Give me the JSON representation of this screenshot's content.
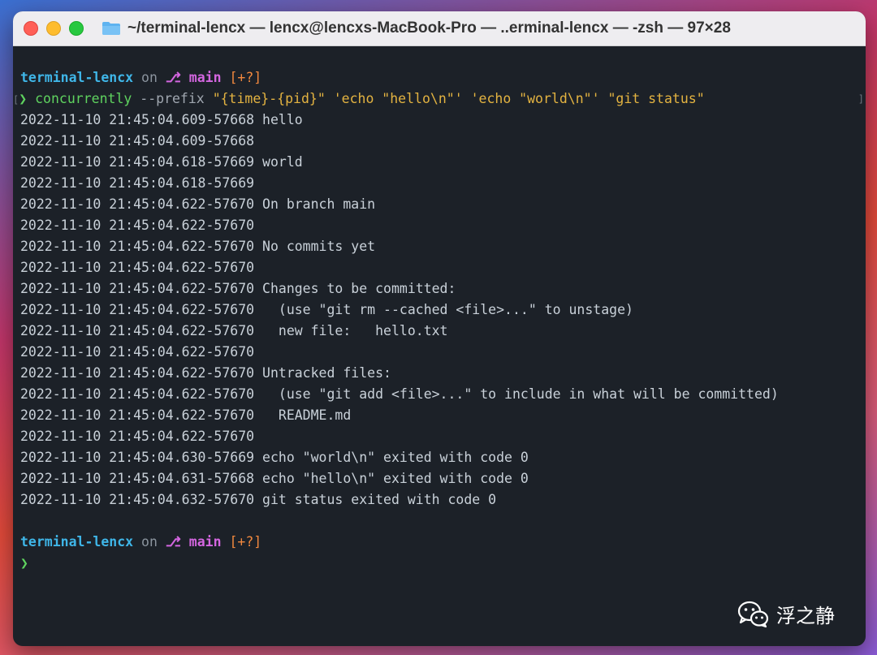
{
  "window": {
    "title": "~/terminal-lencx — lencx@lencxs-MacBook-Pro — ..erminal-lencx — -zsh — 97×28"
  },
  "prompt1": {
    "dir": "terminal-lencx",
    "on": "on",
    "branch_symbol": "⎇",
    "branch": "main",
    "status": "[+?]"
  },
  "command": {
    "arrow": "❯",
    "program": "concurrently",
    "args_flag": "--prefix",
    "arg_prefix": "\"{time}-{pid}\"",
    "arg_rest": "'echo \"hello\\n\"' 'echo \"world\\n\"' \"git status\""
  },
  "output": [
    "2022-11-10 21:45:04.609-57668 hello",
    "2022-11-10 21:45:04.609-57668",
    "2022-11-10 21:45:04.618-57669 world",
    "2022-11-10 21:45:04.618-57669",
    "2022-11-10 21:45:04.622-57670 On branch main",
    "2022-11-10 21:45:04.622-57670",
    "2022-11-10 21:45:04.622-57670 No commits yet",
    "2022-11-10 21:45:04.622-57670",
    "2022-11-10 21:45:04.622-57670 Changes to be committed:",
    "2022-11-10 21:45:04.622-57670   (use \"git rm --cached <file>...\" to unstage)",
    "2022-11-10 21:45:04.622-57670   new file:   hello.txt",
    "2022-11-10 21:45:04.622-57670",
    "2022-11-10 21:45:04.622-57670 Untracked files:",
    "2022-11-10 21:45:04.622-57670   (use \"git add <file>...\" to include in what will be committed)",
    "2022-11-10 21:45:04.622-57670   README.md",
    "2022-11-10 21:45:04.622-57670",
    "2022-11-10 21:45:04.630-57669 echo \"world\\n\" exited with code 0",
    "2022-11-10 21:45:04.631-57668 echo \"hello\\n\" exited with code 0",
    "2022-11-10 21:45:04.632-57670 git status exited with code 0"
  ],
  "prompt2": {
    "dir": "terminal-lencx",
    "on": "on",
    "branch_symbol": "⎇",
    "branch": "main",
    "status": "[+?]",
    "arrow": "❯"
  },
  "watermark": {
    "text": "浮之静"
  },
  "colors": {
    "terminal_bg": "#1c2128",
    "dir": "#3fb6e8",
    "branch": "#d466e0",
    "status": "#f0883e",
    "prompt_arrow": "#5fd35f",
    "string": "#e3b341"
  }
}
